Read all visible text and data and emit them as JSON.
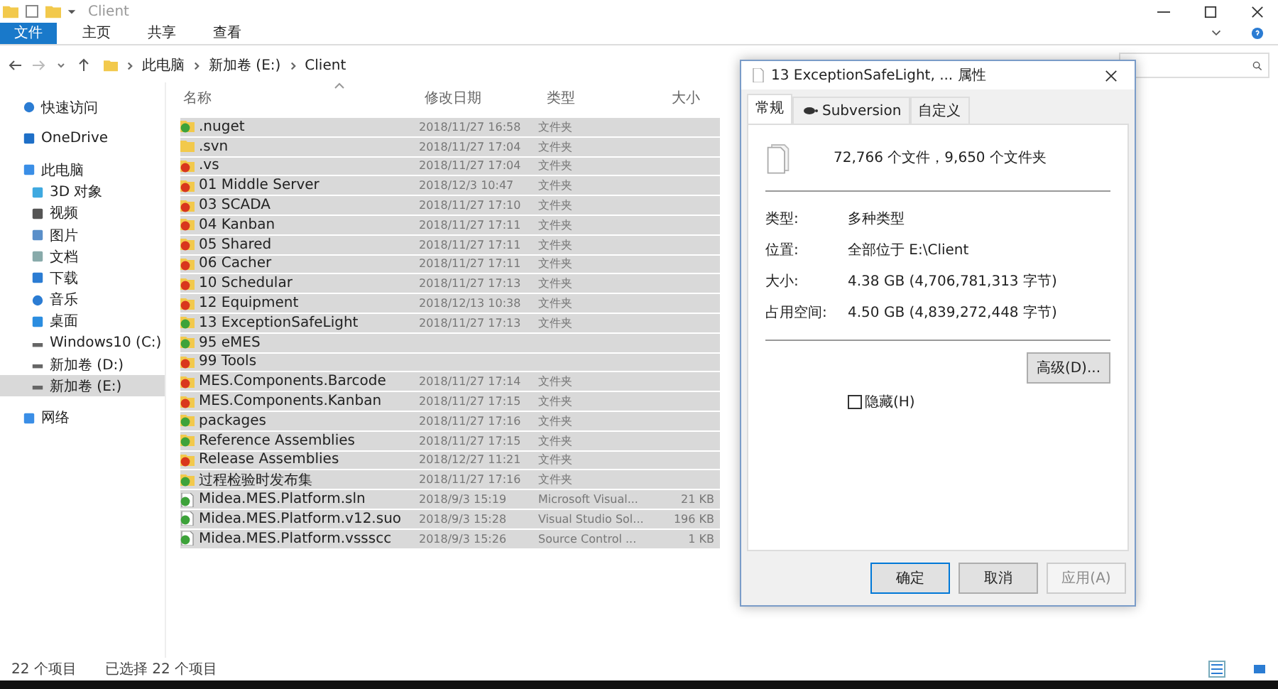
{
  "window": {
    "title": "Client"
  },
  "ribbon_tabs": [
    {
      "label": "文件",
      "selected": true
    },
    {
      "label": "主页",
      "selected": false
    },
    {
      "label": "共享",
      "selected": false
    },
    {
      "label": "查看",
      "selected": false
    }
  ],
  "breadcrumbs": [
    "此电脑",
    "新加卷 (E:)",
    "Client"
  ],
  "sidebar": {
    "items": [
      {
        "label": "快速访问",
        "kind": "star",
        "selected": false
      },
      {
        "label": "OneDrive",
        "kind": "cloud",
        "selected": false
      },
      {
        "label": "此电脑",
        "kind": "pc",
        "selected": false,
        "children": [
          {
            "label": "3D 对象",
            "kind": "cube",
            "selected": false
          },
          {
            "label": "视频",
            "kind": "video",
            "selected": false
          },
          {
            "label": "图片",
            "kind": "image",
            "selected": false
          },
          {
            "label": "文档",
            "kind": "doc",
            "selected": false
          },
          {
            "label": "下载",
            "kind": "download",
            "selected": false
          },
          {
            "label": "音乐",
            "kind": "music",
            "selected": false
          },
          {
            "label": "桌面",
            "kind": "desktop",
            "selected": false
          },
          {
            "label": "Windows10 (C:)",
            "kind": "drive",
            "selected": false
          },
          {
            "label": "新加卷 (D:)",
            "kind": "drive",
            "selected": false
          },
          {
            "label": "新加卷 (E:)",
            "kind": "drive",
            "selected": true
          }
        ]
      },
      {
        "label": "网络",
        "kind": "network",
        "selected": false
      }
    ]
  },
  "table": {
    "columns": [
      "名称",
      "修改日期",
      "类型",
      "大小"
    ],
    "rows": [
      {
        "name": ".nuget",
        "date": "2018/11/27 16:58",
        "type": "文件夹",
        "kind": "folder",
        "color": "#3da23a",
        "selected": true
      },
      {
        "name": ".svn",
        "date": "2018/11/27 17:04",
        "type": "文件夹",
        "kind": "folder",
        "selected": true
      },
      {
        "name": ".vs",
        "date": "2018/11/27 17:04",
        "type": "文件夹",
        "kind": "folder",
        "color": "#d9361d",
        "selected": true
      },
      {
        "name": "01 Middle Server",
        "date": "2018/12/3 10:47",
        "type": "文件夹",
        "kind": "folder",
        "color": "#d9361d",
        "selected": true
      },
      {
        "name": "03 SCADA",
        "date": "2018/11/27 17:10",
        "type": "文件夹",
        "kind": "folder",
        "color": "#d9361d",
        "selected": true
      },
      {
        "name": "04 Kanban",
        "date": "2018/11/27 17:11",
        "type": "文件夹",
        "kind": "folder",
        "color": "#d9361d",
        "selected": true
      },
      {
        "name": "05 Shared",
        "date": "2018/11/27 17:11",
        "type": "文件夹",
        "kind": "folder",
        "color": "#d9361d",
        "selected": true
      },
      {
        "name": "06 Cacher",
        "date": "2018/11/27 17:11",
        "type": "文件夹",
        "kind": "folder",
        "color": "#d9361d",
        "selected": true
      },
      {
        "name": "10 Schedular",
        "date": "2018/11/27 17:13",
        "type": "文件夹",
        "kind": "folder",
        "color": "#d9361d",
        "selected": true
      },
      {
        "name": "12 Equipment",
        "date": "2018/12/13 10:38",
        "type": "文件夹",
        "kind": "folder",
        "color": "#d9361d",
        "selected": true
      },
      {
        "name": "13 ExceptionSafeLight",
        "date": "2018/11/27 17:13",
        "type": "文件夹",
        "kind": "folder",
        "color": "#3da23a",
        "selected": true
      },
      {
        "name": "95 eMES",
        "kind": "folder",
        "color": "#3da23a",
        "selected": true
      },
      {
        "name": "99 Tools",
        "kind": "folder",
        "color": "#d9361d",
        "selected": true
      },
      {
        "name": "MES.Components.Barcode",
        "date": "2018/11/27 17:14",
        "type": "文件夹",
        "kind": "folder",
        "color": "#d9361d",
        "selected": true
      },
      {
        "name": "MES.Components.Kanban",
        "date": "2018/11/27 17:15",
        "type": "文件夹",
        "kind": "folder",
        "color": "#d9361d",
        "selected": true
      },
      {
        "name": "packages",
        "date": "2018/11/27 17:16",
        "type": "文件夹",
        "kind": "folder",
        "color": "#3da23a",
        "selected": true
      },
      {
        "name": "Reference Assemblies",
        "date": "2018/11/27 17:15",
        "type": "文件夹",
        "kind": "folder",
        "color": "#3da23a",
        "selected": true
      },
      {
        "name": "Release Assemblies",
        "date": "2018/12/27 11:21",
        "type": "文件夹",
        "kind": "folder",
        "color": "#d9361d",
        "selected": true
      },
      {
        "name": "过程检验时发布集",
        "date": "2018/11/27 17:16",
        "type": "文件夹",
        "kind": "folder",
        "color": "#3da23a",
        "selected": true
      },
      {
        "name": "Midea.MES.Platform.sln",
        "date": "2018/9/3 15:19",
        "type": "Microsoft Visual...",
        "size": "21 KB",
        "kind": "file",
        "color": "#3da23a",
        "selected": true
      },
      {
        "name": "Midea.MES.Platform.v12.suo",
        "date": "2018/9/3 15:28",
        "type": "Visual Studio Sol...",
        "size": "196 KB",
        "kind": "file",
        "color": "#3da23a",
        "selected": true
      },
      {
        "name": "Midea.MES.Platform.vssscc",
        "date": "2018/9/3 15:26",
        "type": "Source Control ...",
        "size": "1 KB",
        "kind": "file",
        "color": "#3da23a",
        "selected": true
      }
    ]
  },
  "status_bar": {
    "count": "22 个项目",
    "selection": "已选择 22 个项目"
  },
  "dialog": {
    "title": "13 ExceptionSafeLight, ... 属性",
    "tabs": [
      {
        "label": "常规",
        "selected": true,
        "kind": "plain"
      },
      {
        "label": "Subversion",
        "selected": false,
        "kind": "svn"
      },
      {
        "label": "自定义",
        "selected": false,
        "kind": "plain"
      }
    ],
    "summary": "72,766 个文件，9,650 个文件夹",
    "properties": [
      {
        "label": "类型:",
        "value": "多种类型"
      },
      {
        "label": "位置:",
        "value": "全部位于 E:\\Client"
      },
      {
        "label": "大小:",
        "value": "4.38 GB (4,706,781,313 字节)"
      },
      {
        "label": "占用空间:",
        "value": "4.50 GB (4,839,272,448 字节)"
      }
    ],
    "advanced_button": "高级(D)...",
    "hidden_checkbox": {
      "label": "隐藏(H)",
      "checked": false
    },
    "buttons": [
      {
        "label": "确定",
        "kind": "default",
        "disabled": false
      },
      {
        "label": "取消",
        "kind": "normal",
        "disabled": false
      },
      {
        "label": "应用(A)",
        "kind": "normal",
        "disabled": true
      }
    ]
  }
}
